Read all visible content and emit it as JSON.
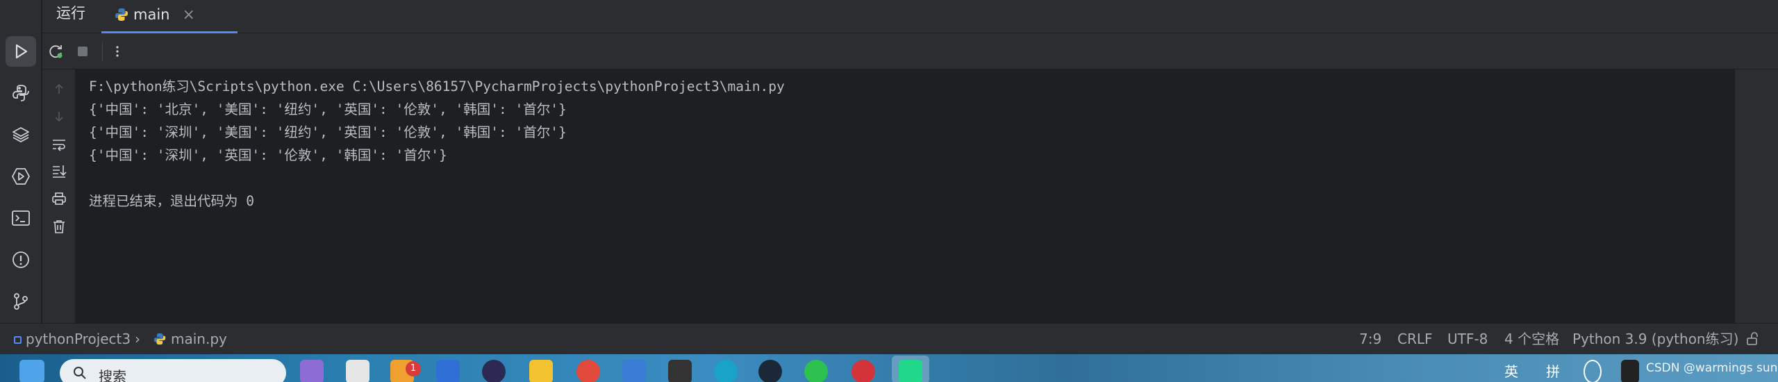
{
  "tool_window": {
    "title": "运行",
    "tab": {
      "label": "main",
      "close": "×"
    }
  },
  "console": {
    "lines": [
      "F:\\python练习\\Scripts\\python.exe C:\\Users\\86157\\PycharmProjects\\pythonProject3\\main.py",
      "{'中国': '北京', '美国': '纽约', '英国': '伦敦', '韩国': '首尔'}",
      "{'中国': '深圳', '美国': '纽约', '英国': '伦敦', '韩国': '首尔'}",
      "{'中国': '深圳', '英国': '伦敦', '韩国': '首尔'}",
      "",
      "进程已结束，退出代码为 0"
    ]
  },
  "status_bar": {
    "project": "pythonProject3",
    "file": "main.py",
    "position": "7:9",
    "line_ending": "CRLF",
    "encoding": "UTF-8",
    "indent": "4 个空格",
    "interpreter": "Python 3.9 (python练习)"
  },
  "taskbar": {
    "search_label": "搜索",
    "notification_count": "1",
    "ime_label": "英",
    "layout_label": "拼",
    "watermark": "CSDN @warmings sun"
  },
  "colors": {
    "accent": "#548af7",
    "background": "#1e1f22",
    "panel": "#2b2d30",
    "text": "#bcbec4"
  },
  "icons": {
    "run": "play-icon",
    "python_console": "python-icon",
    "layers": "layers-icon",
    "services": "services-icon",
    "terminal": "terminal-icon",
    "problems": "problems-icon",
    "git": "git-icon",
    "rerun": "rerun-icon",
    "stop": "stop-icon",
    "more": "more-icon"
  }
}
